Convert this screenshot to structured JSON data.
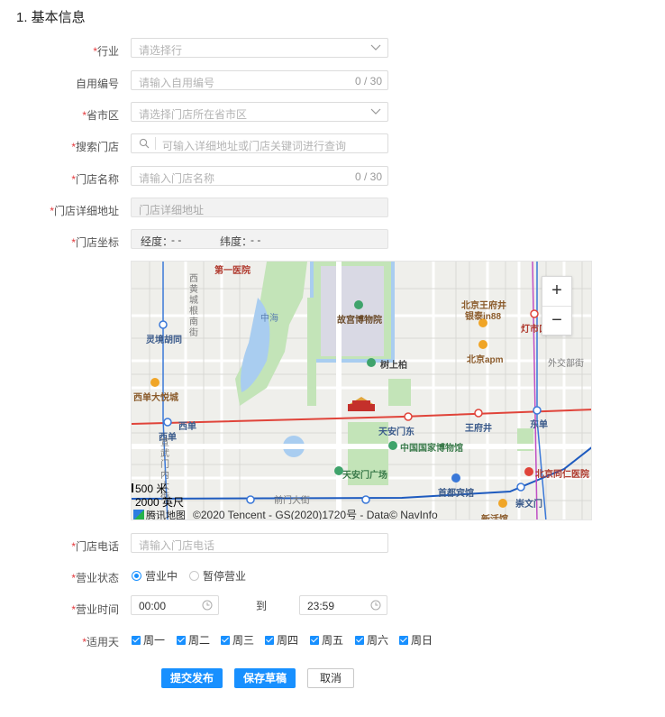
{
  "section_title": "1. 基本信息",
  "required_mark": "*",
  "fields": {
    "industry": {
      "label": "行业",
      "placeholder": "请选择行"
    },
    "custom_code": {
      "label": "自用编号",
      "placeholder": "请输入自用编号",
      "counter": "0 / 30"
    },
    "province": {
      "label": "省市区",
      "placeholder": "请选择门店所在省市区"
    },
    "search_store": {
      "label": "搜索门店",
      "placeholder": "可输入详细地址或门店关键词进行查询"
    },
    "store_name": {
      "label": "门店名称",
      "placeholder": "请输入门店名称",
      "counter": "0 / 30"
    },
    "address": {
      "label": "门店详细地址",
      "placeholder": "门店详细地址"
    },
    "coords": {
      "label": "门店坐标",
      "lng_label": "经度：",
      "lng_value": "- -",
      "lat_label": "纬度：",
      "lat_value": "- -"
    },
    "phone": {
      "label": "门店电话",
      "placeholder": "请输入门店电话"
    }
  },
  "map": {
    "zoom_in": "+",
    "zoom_out": "−",
    "scale_metric": "500 米",
    "scale_imperial": "2000 英尺",
    "logo_text": "腾讯地图",
    "attribution": "©2020 Tencent - GS(2020)1720号 - Data© NavInfo",
    "labels": {
      "l1": "第一医院",
      "l2": "故宫博物院",
      "l3": "中海",
      "l4": "北京王府井",
      "l5": "银泰in88",
      "l6": "灯市口",
      "l7": "灵境胡同",
      "l8": "北京apm",
      "l9": "树上柏",
      "l10": "西单大悦城",
      "l11": "外交部街",
      "l12": "西单",
      "l13": "天安门东",
      "l14": "王府井",
      "l15": "东单",
      "l16": "中国国家博物馆",
      "l17": "西单",
      "l18": "天安门广场",
      "l19": "北京同仁医院",
      "l20": "首都宾馆",
      "l21": "崇文门",
      "l22": "新活馆",
      "l23": "前门大街",
      "l24": "西黄城根南街",
      "l25": "宣武门内大街"
    }
  },
  "status": {
    "label": "营业状态",
    "open": "营业中",
    "paused": "暂停营业",
    "selected": "营业中"
  },
  "hours": {
    "label": "营业时间",
    "start": "00:00",
    "to": "到",
    "end": "23:59"
  },
  "days": {
    "label": "适用天",
    "items": [
      "周一",
      "周二",
      "周三",
      "周四",
      "周五",
      "周六",
      "周日"
    ]
  },
  "buttons": {
    "submit": "提交发布",
    "draft": "保存草稿",
    "cancel": "取消"
  },
  "colors": {
    "primary": "#1890ff",
    "required": "#e4393c",
    "road_red": "#e0443a",
    "metro_blue": "#3a78d8",
    "park_green": "#bfe3b4",
    "water": "#a9cdf0"
  }
}
